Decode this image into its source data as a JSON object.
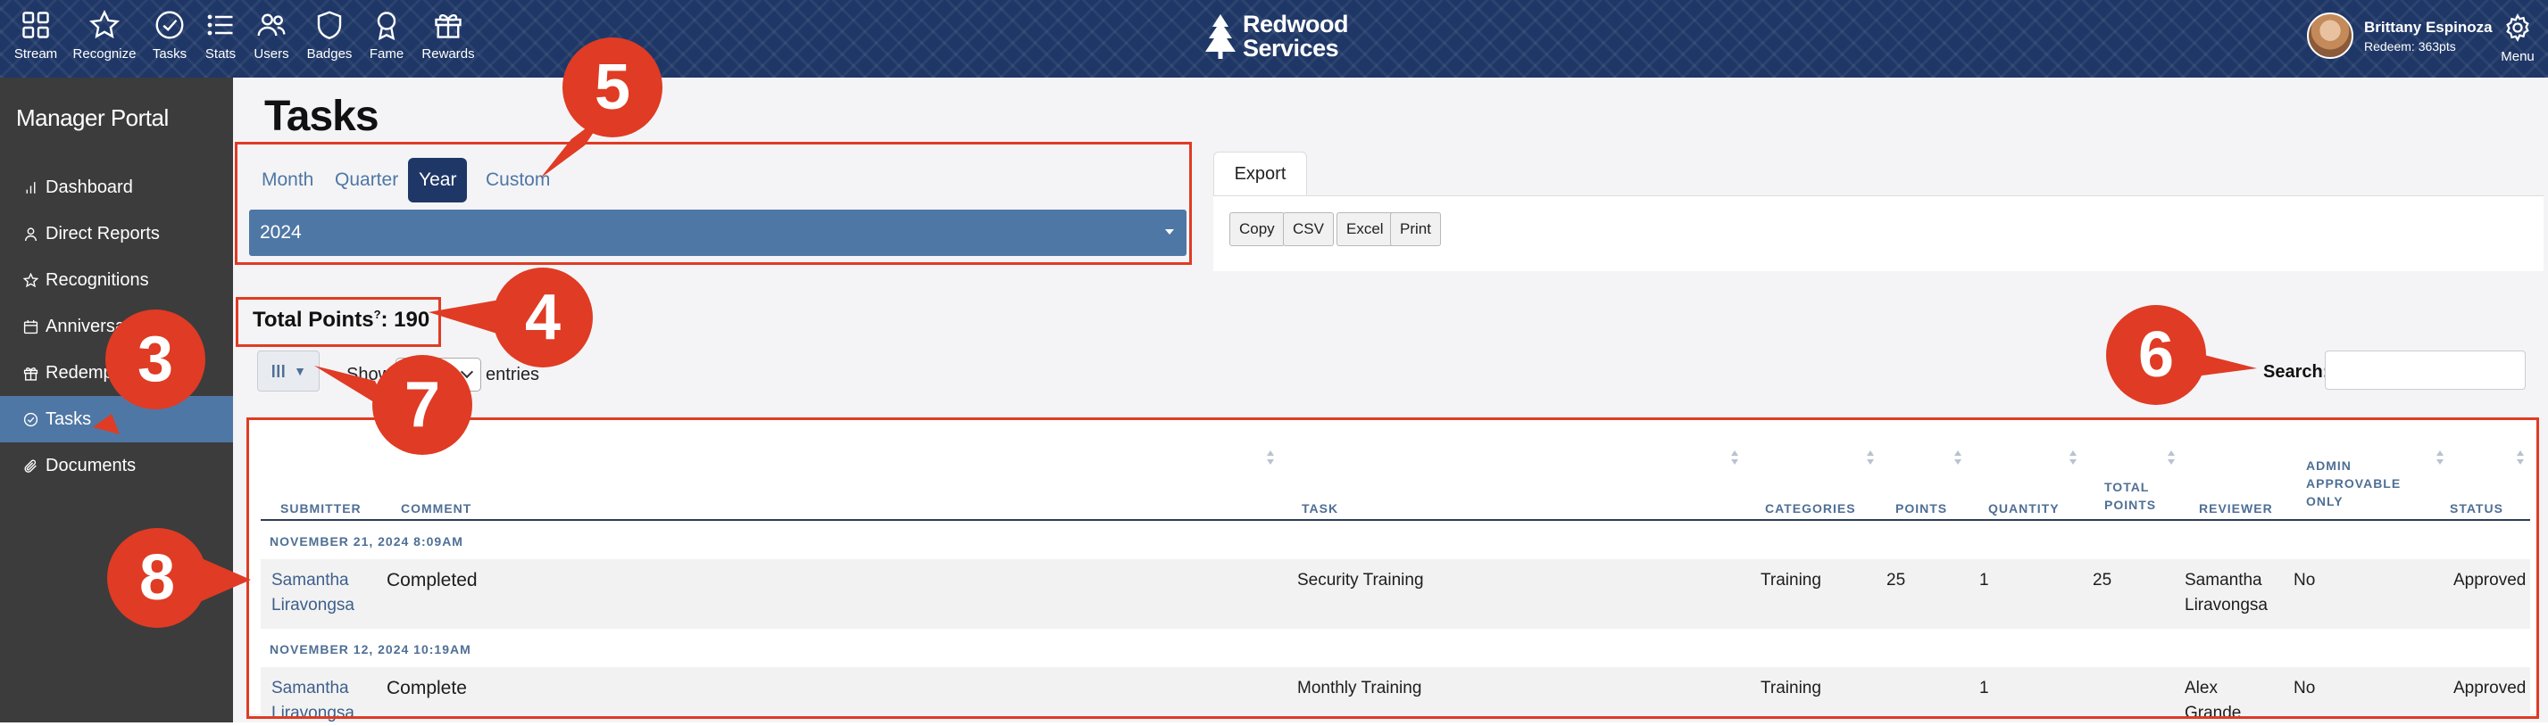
{
  "topnav": {
    "items": [
      {
        "label": "Stream",
        "icon": "grid-icon"
      },
      {
        "label": "Recognize",
        "icon": "star-icon"
      },
      {
        "label": "Tasks",
        "icon": "check-circle-icon"
      },
      {
        "label": "Stats",
        "icon": "list-icon"
      },
      {
        "label": "Users",
        "icon": "users-icon"
      },
      {
        "label": "Badges",
        "icon": "shield-icon"
      },
      {
        "label": "Fame",
        "icon": "award-icon"
      },
      {
        "label": "Rewards",
        "icon": "gift-icon"
      }
    ],
    "brand_line1": "Redwood",
    "brand_line2": "Services",
    "user_name": "Brittany Espinoza",
    "user_points": "Redeem: 363pts",
    "menu_label": "Menu"
  },
  "sidebar": {
    "title": "Manager Portal",
    "items": [
      {
        "label": "Dashboard",
        "icon": "bar-chart-icon"
      },
      {
        "label": "Direct Reports",
        "icon": "person-icon"
      },
      {
        "label": "Recognitions",
        "icon": "star-icon"
      },
      {
        "label": "Anniversa",
        "icon": "calendar-icon"
      },
      {
        "label": "Redemp",
        "icon": "gift-icon"
      },
      {
        "label": "Tasks",
        "icon": "check-circle-icon"
      },
      {
        "label": "Documents",
        "icon": "paperclip-icon"
      }
    ]
  },
  "page": {
    "title": "Tasks",
    "period_tabs": [
      "Month",
      "Quarter",
      "Year",
      "Custom"
    ],
    "active_period": "Year",
    "year_value": "2024",
    "export_tab": "Export",
    "export_buttons": [
      "Copy",
      "CSV",
      "Excel",
      "Print"
    ],
    "total_points_label": "Total Points",
    "total_points_sup": "?",
    "total_points_value": ": 190",
    "show_label": "Show",
    "entries_label": "entries",
    "search_label": "Search:",
    "column_vis_icon": "columns-icon"
  },
  "table": {
    "headers": {
      "submitter": "SUBMITTER",
      "comment": "COMMENT",
      "task": "TASK",
      "categories": "CATEGORIES",
      "points": "POINTS",
      "quantity": "QUANTITY",
      "total_points_1": "TOTAL",
      "total_points_2": "POINTS",
      "reviewer": "REVIEWER",
      "admin_1": "ADMIN",
      "admin_2": "APPROVABLE",
      "admin_3": "ONLY",
      "status": "STATUS"
    },
    "groups": [
      {
        "date": "NOVEMBER 21, 2024 8:09AM",
        "row": {
          "submitter_1": "Samantha",
          "submitter_2": "Liravongsa",
          "comment": "Completed",
          "task": "Security Training",
          "categories": "Training",
          "points": "25",
          "quantity": "1",
          "total_points": "25",
          "reviewer_1": "Samantha",
          "reviewer_2": "Liravongsa",
          "admin_only": "No",
          "status": "Approved"
        }
      },
      {
        "date": "NOVEMBER 12, 2024 10:19AM",
        "row": {
          "submitter_1": "Samantha",
          "submitter_2": "Liravongsa",
          "comment": "Complete",
          "task": "Monthly Training",
          "categories": "Training",
          "points": "",
          "quantity": "1",
          "total_points": "",
          "reviewer_1": "Alex",
          "reviewer_2": "Grande",
          "admin_only": "No",
          "status": "Approved"
        }
      }
    ]
  },
  "callouts": [
    "3",
    "4",
    "5",
    "6",
    "7",
    "8"
  ],
  "colors": {
    "navy": "#1f3766",
    "accent_blue": "#4f77a5",
    "sidebar_bg": "#3c3c3c",
    "callout_red": "#e03b24"
  }
}
